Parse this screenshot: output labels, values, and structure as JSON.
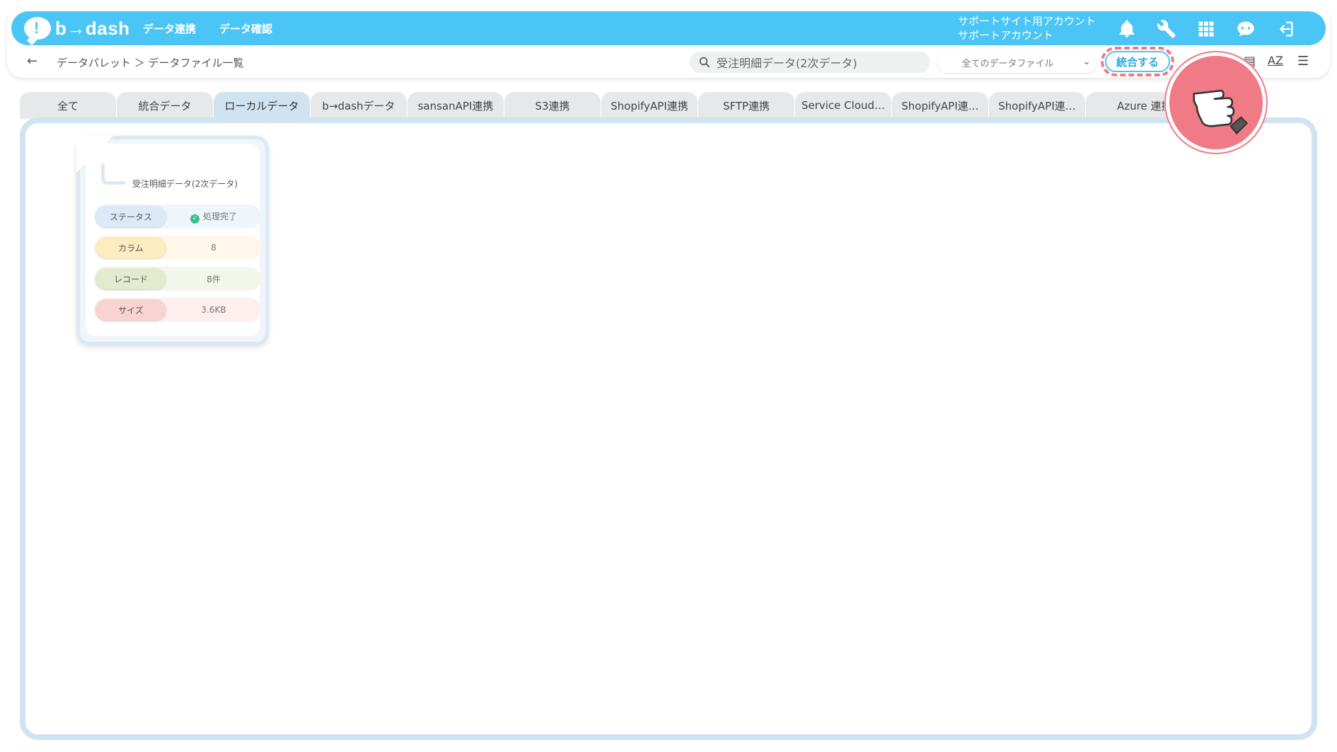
{
  "brand": {
    "logo_text": "b→dash",
    "accent": "#4ac5f5"
  },
  "nav": {
    "item1": "データ連携",
    "item2": "データ確認"
  },
  "account": {
    "line1": "サポートサイト用アカウント",
    "line2": "サポートアカウント"
  },
  "header_icons": [
    "bell-icon",
    "wrench-icon",
    "grid-icon",
    "support-chat-icon",
    "logout-icon"
  ],
  "breadcrumb": {
    "back": "←",
    "text": "データパレット ＞ データファイル一覧"
  },
  "search": {
    "value": "受注明細データ(2次データ)"
  },
  "filter": {
    "selected": "全てのデータファイル"
  },
  "merge_button": {
    "label": "統合する"
  },
  "toolbar_icons": [
    "view-icon",
    "sort-az-icon",
    "list-view-icon"
  ],
  "sort_label": "AZ",
  "tabs": [
    {
      "label": "全て"
    },
    {
      "label": "統合データ"
    },
    {
      "label": "ローカルデータ",
      "active": true
    },
    {
      "label": "b→dashデータ"
    },
    {
      "label": "sansanAPI連携"
    },
    {
      "label": "S3連携"
    },
    {
      "label": "ShopifyAPI連携"
    },
    {
      "label": "SFTP連携"
    },
    {
      "label": "Service Cloud…"
    },
    {
      "label": "ShopifyAPI連…"
    },
    {
      "label": "ShopifyAPI連…"
    },
    {
      "label": "Azure 連携"
    }
  ],
  "card": {
    "title": "受注明細データ(2次データ)",
    "status_label": "ステータス",
    "status_value": "処理完了",
    "column_label": "カラム",
    "column_value": "8",
    "record_label": "レコード",
    "record_value": "8件",
    "size_label": "サイズ",
    "size_value": "3.6KB"
  }
}
